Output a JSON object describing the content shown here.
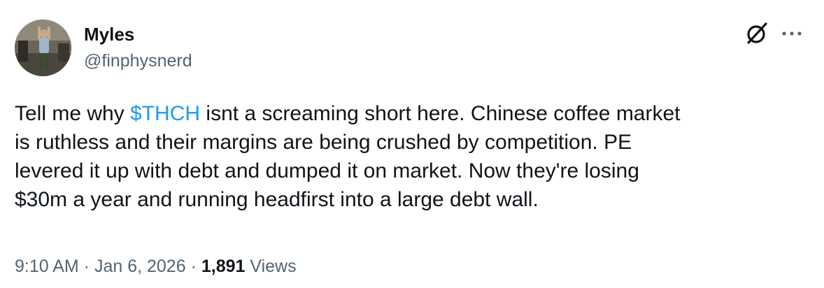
{
  "author": {
    "display_name": "Myles",
    "handle": "@finphysnerd"
  },
  "icons": {
    "grok": "grok-icon",
    "more": "more-dots-icon"
  },
  "tweet": {
    "text_before": "Tell me why ",
    "cashtag": "$THCH",
    "text_after": " isnt a screaming short here. Chinese coffee market\nis ruthless and their margins are being crushed by competition. PE\nlevered it up with debt and dumped it on market.  Now they're losing\n$30m a year and running headfirst into a large debt wall."
  },
  "meta": {
    "time": "9:10 AM",
    "separator": " · ",
    "date": "Jan 6, 2026",
    "views_count": "1,891",
    "views_label": " Views"
  },
  "colors": {
    "link": "#1d9bf0",
    "secondary_text": "#536471",
    "primary_text": "#0f1419"
  }
}
